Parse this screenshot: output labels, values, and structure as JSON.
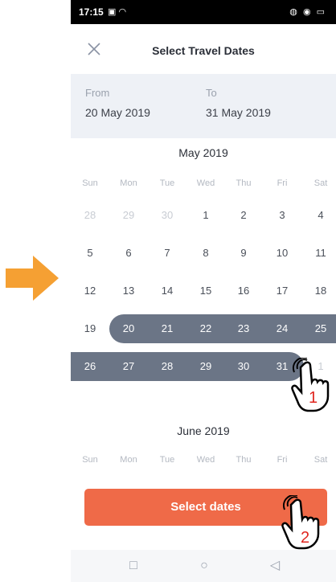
{
  "status": {
    "time": "17:15",
    "left_icons": "▣ ◠",
    "right_icons": "◍ ◉ ▭"
  },
  "header": {
    "title": "Select Travel Dates",
    "close_icon": "close-icon"
  },
  "range": {
    "from_label": "From",
    "from_value": "20 May 2019",
    "to_label": "To",
    "to_value": "31 May 2019"
  },
  "weekdays": [
    "Sun",
    "Mon",
    "Tue",
    "Wed",
    "Thu",
    "Fri",
    "Sat"
  ],
  "may": {
    "title": "May 2019",
    "weeks": [
      [
        "28",
        "29",
        "30",
        "1",
        "2",
        "3",
        "4"
      ],
      [
        "5",
        "6",
        "7",
        "8",
        "9",
        "10",
        "11"
      ],
      [
        "12",
        "13",
        "14",
        "15",
        "16",
        "17",
        "18"
      ],
      [
        "19",
        "20",
        "21",
        "22",
        "23",
        "24",
        "25"
      ],
      [
        "26",
        "27",
        "28",
        "29",
        "30",
        "31",
        "1"
      ]
    ]
  },
  "june": {
    "title": "June 2019"
  },
  "action": {
    "select_label": "Select dates"
  },
  "nav": {
    "recent": "□",
    "home": "○",
    "back": "◁"
  },
  "annotations": {
    "step1": "1",
    "step2": "2"
  },
  "colors": {
    "accent": "#ef6a48",
    "range": "#6b7586",
    "panel": "#eef1f6",
    "arrow": "#f5a033"
  }
}
